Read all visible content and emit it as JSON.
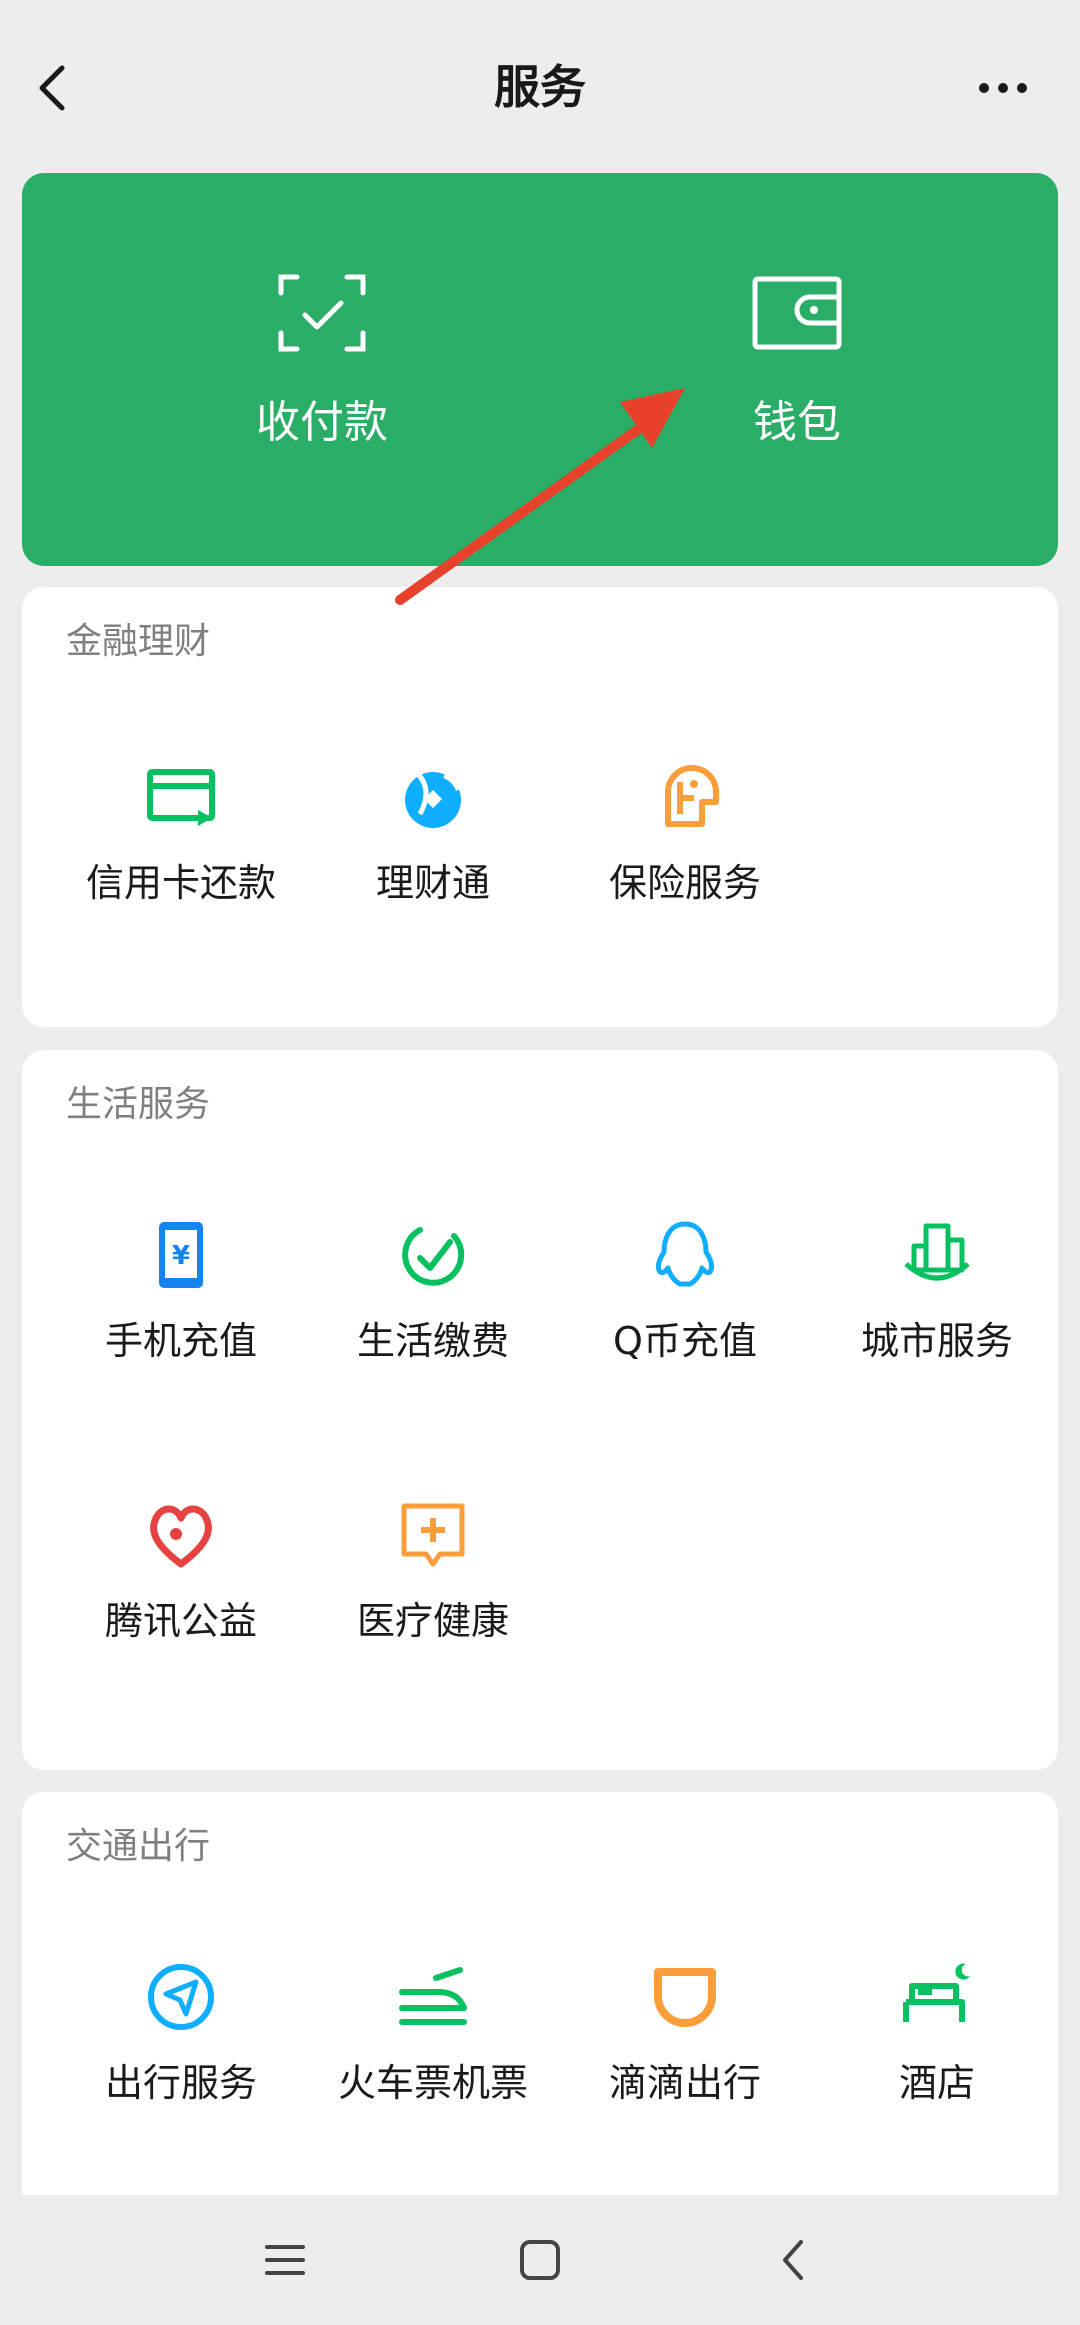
{
  "header": {
    "title": "服务"
  },
  "top_actions": [
    {
      "label": "收付款",
      "icon": "scan-icon"
    },
    {
      "label": "钱包",
      "icon": "wallet-icon"
    }
  ],
  "sections": {
    "finance": {
      "title": "金融理财",
      "items": [
        {
          "label": "信用卡还款",
          "icon": "credit-card-icon",
          "color": "#07c160"
        },
        {
          "label": "理财通",
          "icon": "wealth-icon",
          "color": "#10aeff"
        },
        {
          "label": "保险服务",
          "icon": "insurance-icon",
          "color": "#fa9d3b"
        }
      ]
    },
    "life": {
      "title": "生活服务",
      "items": [
        {
          "label": "手机充值",
          "icon": "phone-icon",
          "color": "#1485ee"
        },
        {
          "label": "生活缴费",
          "icon": "bill-icon",
          "color": "#07c160"
        },
        {
          "label": "Q币充值",
          "icon": "qq-icon",
          "color": "#10aeff"
        },
        {
          "label": "城市服务",
          "icon": "city-icon",
          "color": "#07c160"
        },
        {
          "label": "腾讯公益",
          "icon": "charity-icon",
          "color": "#e64340"
        },
        {
          "label": "医疗健康",
          "icon": "medical-icon",
          "color": "#fa9d3b"
        }
      ]
    },
    "travel": {
      "title": "交通出行",
      "items": [
        {
          "label": "出行服务",
          "icon": "navigation-icon",
          "color": "#10aeff"
        },
        {
          "label": "火车票机票",
          "icon": "train-icon",
          "color": "#07c160"
        },
        {
          "label": "滴滴出行",
          "icon": "didi-icon",
          "color": "#fa9d3b"
        },
        {
          "label": "酒店",
          "icon": "hotel-icon",
          "color": "#07c160"
        }
      ]
    }
  },
  "colors": {
    "brand_green": "#2aae67",
    "background": "#ededed",
    "annotation_arrow": "#e8412b"
  }
}
